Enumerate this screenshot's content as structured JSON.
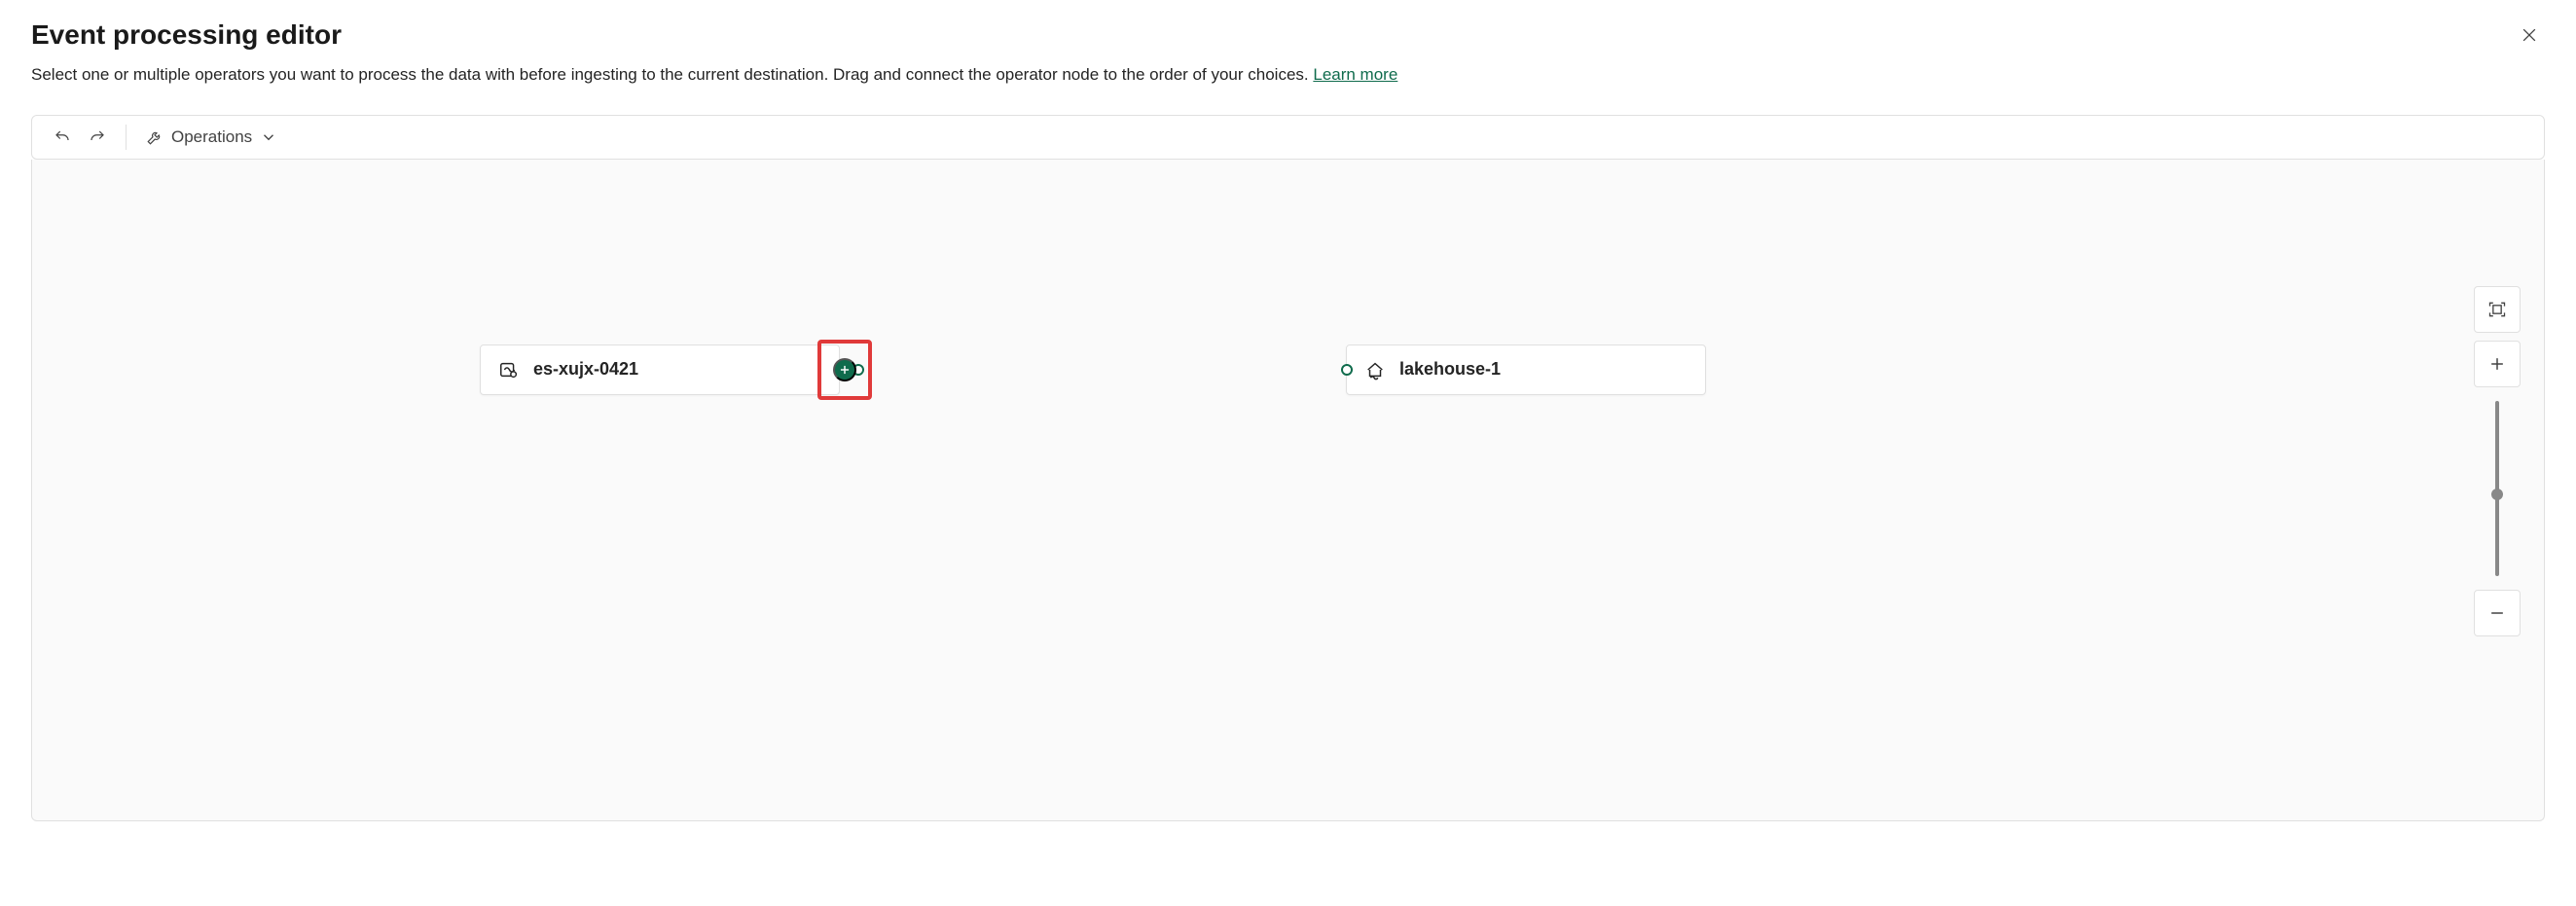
{
  "header": {
    "title": "Event processing editor",
    "subtitle": "Select one or multiple operators you want to process the data with before ingesting to the current destination. Drag and connect the operator node to the order of your choices.",
    "learn_more": "Learn more"
  },
  "toolbar": {
    "operations_label": "Operations"
  },
  "nodes": {
    "source": {
      "label": "es-xujx-0421"
    },
    "destination": {
      "label": "lakehouse-1"
    }
  },
  "colors": {
    "accent": "#0f6b4c",
    "highlight": "#e03a3a"
  }
}
